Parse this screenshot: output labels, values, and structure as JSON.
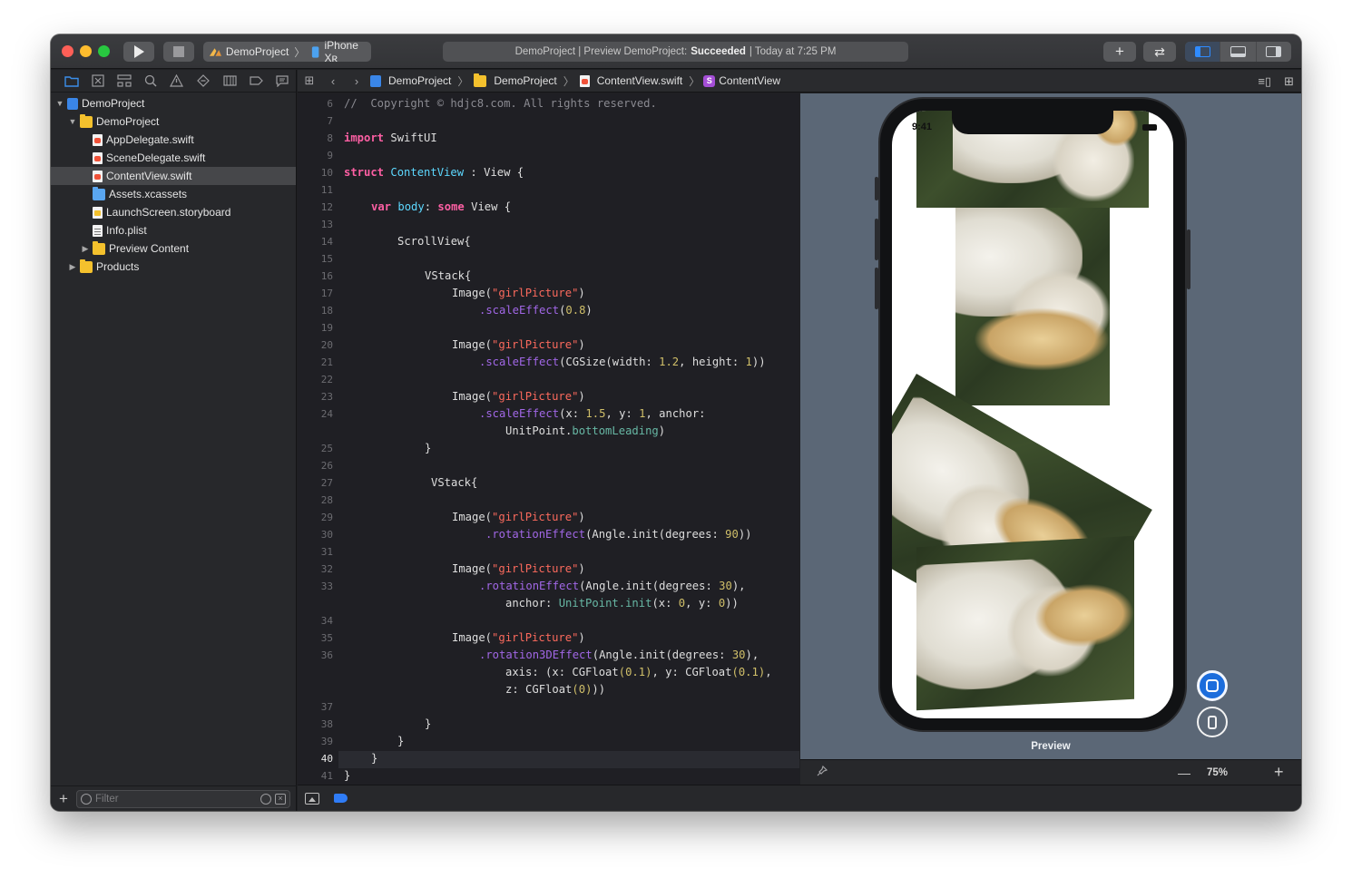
{
  "toolbar": {
    "scheme_project": "DemoProject",
    "scheme_device": "iPhone Xʀ",
    "status_prefix": "DemoProject | Preview DemoProject:",
    "status_result": "Succeeded",
    "status_suffix": "| Today at 7:25 PM"
  },
  "navigator": {
    "items": [
      {
        "label": "DemoProject"
      },
      {
        "label": "DemoProject"
      },
      {
        "label": "AppDelegate.swift"
      },
      {
        "label": "SceneDelegate.swift"
      },
      {
        "label": "ContentView.swift"
      },
      {
        "label": "Assets.xcassets"
      },
      {
        "label": "LaunchScreen.storyboard"
      },
      {
        "label": "Info.plist"
      },
      {
        "label": "Preview Content"
      },
      {
        "label": "Products"
      }
    ],
    "filter_placeholder": "Filter"
  },
  "jumpbar": {
    "crumbs": [
      "DemoProject",
      "DemoProject",
      "ContentView.swift",
      "ContentView"
    ],
    "symbol_badge": "S"
  },
  "editor": {
    "current_line": "40",
    "line_numbers": [
      "6",
      "7",
      "8",
      "9",
      "10",
      "11",
      "12",
      "13",
      "14",
      "15",
      "16",
      "17",
      "18",
      "19",
      "20",
      "21",
      "22",
      "23",
      "24",
      "25",
      "26",
      "27",
      "28",
      "29",
      "30",
      "31",
      "32",
      "33",
      "34",
      "35",
      "36",
      "37",
      "38",
      "39",
      "40",
      "41"
    ],
    "code": {
      "l6": "//  Copyright © hdjc8.com. All rights reserved.",
      "l8_kw": "import",
      "l8_mod": "SwiftUI",
      "l10_kw": "struct",
      "l10_name": "ContentView",
      "l10_rest": " : View {",
      "l12_kw1": "var",
      "l12_body": "body",
      "l12_kw2": "some",
      "l12_rest": "View {",
      "l14": "ScrollView{",
      "l16": "VStack{",
      "img": "Image(",
      "pic": "\"girlPicture\"",
      "close": ")",
      "l18_fn": ".scaleEffect",
      "l18_num": "0.8",
      "l21_fn": ".scaleEffect",
      "l21_a": "(CGSize(width: ",
      "l21_n1": "1.2",
      "l21_b": ", height: ",
      "l21_n2": "1",
      "l21_c": "))",
      "l24_fn": ".scaleEffect",
      "l24_a": "(x: ",
      "l24_n1": "1.5",
      "l24_b": ", y: ",
      "l24_n2": "1",
      "l24_c": ", anchor:",
      "l24b_a": "UnitPoint.",
      "l24b_id": "bottomLeading",
      "l24b_c": ")",
      "l25": "}",
      "l27": "VStack{",
      "l30_fn": ".rotationEffect",
      "l30_a": "(Angle.init(degrees: ",
      "l30_n": "90",
      "l30_c": "))",
      "l33_fn": ".rotationEffect",
      "l33_a": "(Angle.init(degrees: ",
      "l33_n": "30",
      "l33_c": "),",
      "l33b_a": "anchor: ",
      "l33b_id": "UnitPoint.init",
      "l33b_b": "(x: ",
      "l33b_n1": "0",
      "l33b_c": ", y: ",
      "l33b_n2": "0",
      "l33b_d": "))",
      "l36_fn": ".rotation3DEffect",
      "l36_a": "(Angle.init(degrees: ",
      "l36_n": "30",
      "l36_c": "),",
      "l36b_a": "axis: (x: ",
      "l36b_cg1": "CGFloat",
      "l36b_n1": "(0.1)",
      "l36b_b": ", y: ",
      "l36b_cg2": "CGFloat",
      "l36b_n2": "(0.1)",
      "l36b_c": ",",
      "l36c_a": "z: ",
      "l36c_cg": "CGFloat",
      "l36c_n": "(0)",
      "l36c_c": "))",
      "l38": "}",
      "l39": "}",
      "l40": "}",
      "l41": "}"
    }
  },
  "preview": {
    "label": "Preview",
    "zoom": "75%",
    "status_time": "9:41"
  }
}
